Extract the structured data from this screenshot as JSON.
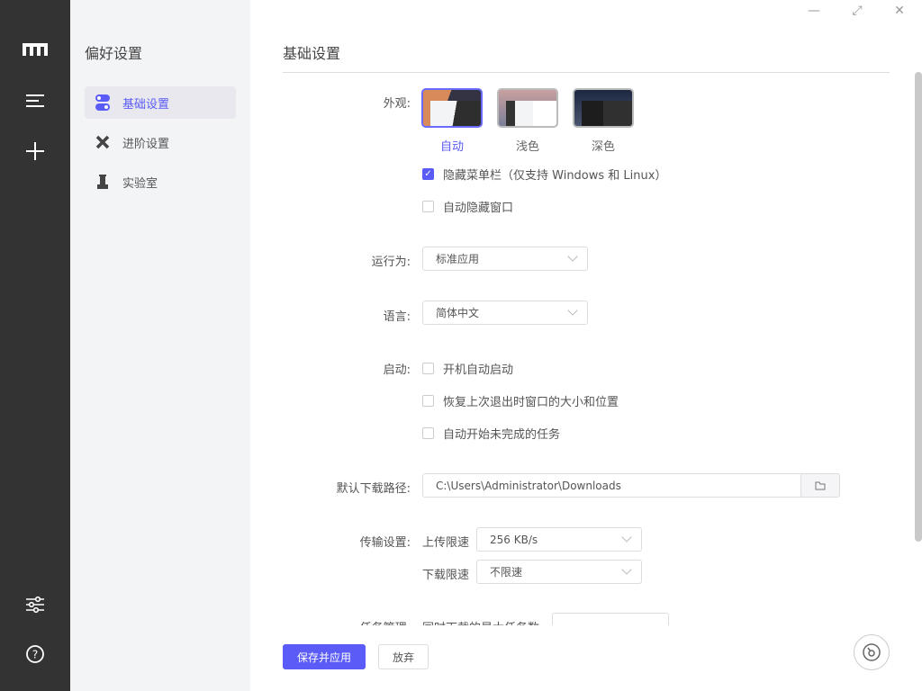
{
  "nav": {
    "icons": [
      "logo-icon",
      "menu-icon",
      "add-icon",
      "settings-icon",
      "help-icon"
    ]
  },
  "sidebar": {
    "title": "偏好设置",
    "items": [
      {
        "label": "基础设置"
      },
      {
        "label": "进阶设置"
      },
      {
        "label": "实验室"
      }
    ]
  },
  "window": {
    "minimize": "—",
    "maximize": "⤢",
    "close": "✕"
  },
  "main": {
    "title": "基础设置",
    "appearance": {
      "label": "外观:",
      "themes": [
        {
          "label": "自动",
          "selected": true
        },
        {
          "label": "浅色"
        },
        {
          "label": "深色"
        }
      ],
      "hide_menu": {
        "label": "隐藏菜单栏（仅支持 Windows 和 Linux）",
        "checked": true
      },
      "auto_hide": {
        "label": "自动隐藏窗口",
        "checked": false
      }
    },
    "run_as": {
      "label": "运行为:",
      "value": "标准应用"
    },
    "language": {
      "label": "语言:",
      "value": "简体中文"
    },
    "startup": {
      "label": "启动:",
      "options": [
        {
          "label": "开机自动启动",
          "checked": false
        },
        {
          "label": "恢复上次退出时窗口的大小和位置",
          "checked": false
        },
        {
          "label": "自动开始未完成的任务",
          "checked": false
        }
      ]
    },
    "download_path": {
      "label": "默认下载路径:",
      "value": "C:\\Users\\Administrator\\Downloads"
    },
    "transfer": {
      "label": "传输设置:",
      "upload_label": "上传限速",
      "upload_value": "256 KB/s",
      "download_label": "下载限速",
      "download_value": "不限速"
    },
    "task": {
      "label": "任务管理:",
      "max_label": "同时下载的最大任务数"
    }
  },
  "footer": {
    "save": "保存并应用",
    "discard": "放弃"
  },
  "colors": {
    "accent": "#5b5bf7"
  }
}
